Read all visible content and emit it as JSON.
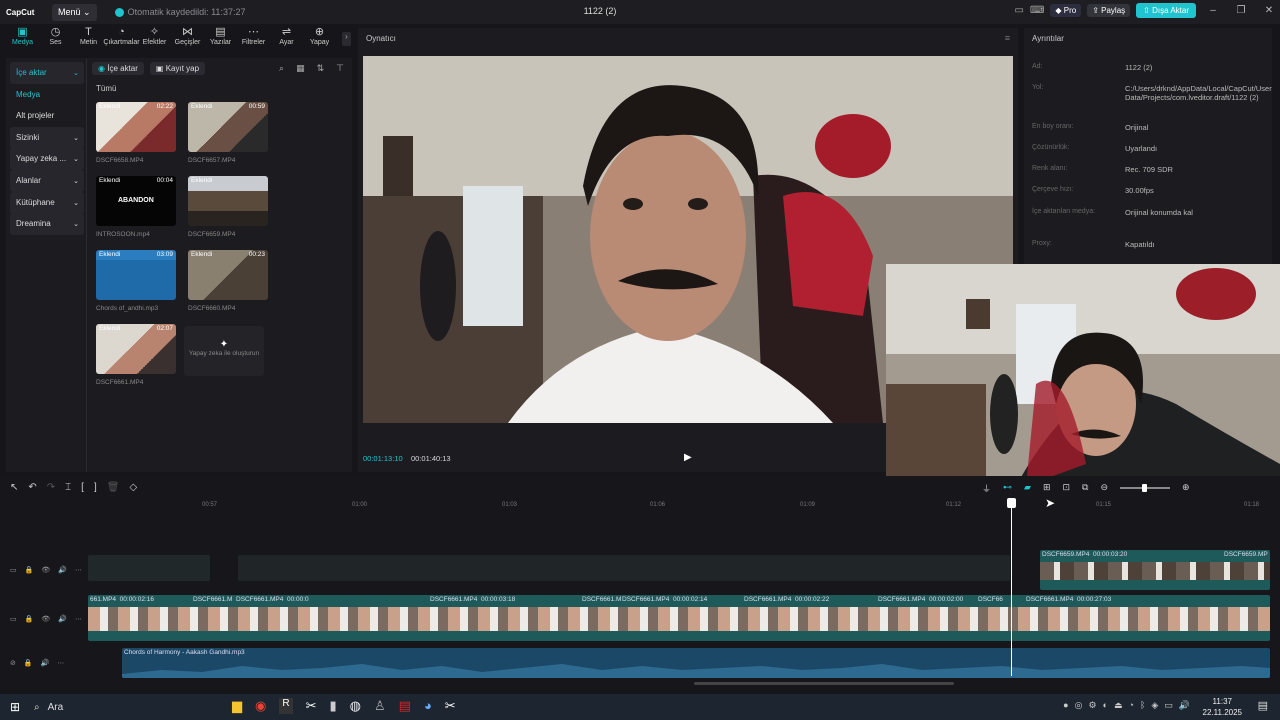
{
  "titlebar": {
    "logo": "CapCut",
    "menu_label": "Menü",
    "autosave": "Otomatik kaydedildi: 11:37:27",
    "project_title": "1122 (2)",
    "pro": "Pro",
    "share": "Paylaş",
    "export": "Dışa Aktar"
  },
  "tooltabs": [
    "Medya",
    "Ses",
    "Metin",
    "Çıkartmalar",
    "Efektler",
    "Geçişler",
    "Yazılar",
    "Filtreler",
    "Ayar",
    "Yapay"
  ],
  "sidebar": {
    "items": [
      {
        "label": "İçe aktar",
        "group": true
      },
      {
        "label": "Medya",
        "group": false
      },
      {
        "label": "Alt projeler",
        "group": false
      },
      {
        "label": "Sizinki",
        "group": true
      },
      {
        "label": "Yapay zeka ...",
        "group": true
      },
      {
        "label": "Alanlar",
        "group": true
      },
      {
        "label": "Kütüphane",
        "group": true
      },
      {
        "label": "Dreamina",
        "group": true
      }
    ]
  },
  "media": {
    "import_tab": "İçe aktar",
    "record_tab": "Kayıt yap",
    "all_label": "Tümü",
    "clips": [
      {
        "tag": "Eklendi",
        "duration": "02:22",
        "name": "DSCF6658.MP4"
      },
      {
        "tag": "Eklendi",
        "duration": "00:59",
        "name": "DSCF6657.MP4"
      },
      {
        "tag": "Eklendi",
        "duration": "00:04",
        "name": "INTROSOON.mp4",
        "overlay": "ABANDON"
      },
      {
        "tag": "Eklendi",
        "duration": "",
        "name": "DSCF6659.MP4"
      },
      {
        "tag": "Eklendi",
        "duration": "03:09",
        "name": "Chords of_andhi.mp3"
      },
      {
        "tag": "Eklendi",
        "duration": "00:23",
        "name": "DSCF6660.MP4"
      },
      {
        "tag": "Eklendi",
        "duration": "02:07",
        "name": "DSCF6661.MP4"
      }
    ],
    "ai_create": "Yapay zeka ile oluşturun"
  },
  "player": {
    "title": "Oynatıcı",
    "current_time": "00:01:13:10",
    "total_time": "00:01:40:13"
  },
  "details": {
    "title": "Ayrıntılar",
    "rows": [
      {
        "k": "Ad:",
        "v": "1122 (2)"
      },
      {
        "k": "Yol:",
        "v": "C:/Users/drknd/AppData/Local/CapCut/User Data/Projects/com.lveditor.draft/1122 (2)"
      },
      {
        "k": "En boy oranı:",
        "v": "Orijinal"
      },
      {
        "k": "Çözünürlük:",
        "v": "Uyarlandı"
      },
      {
        "k": "Renk alanı:",
        "v": "Rec. 709 SDR"
      },
      {
        "k": "Çerçeve hızı:",
        "v": "30.00fps"
      },
      {
        "k": "İçe aktarılan medya:",
        "v": "Orijinal konumda kal"
      },
      {
        "k": "Proxy:",
        "v": "Kapatıldı"
      }
    ]
  },
  "timeline": {
    "ruler": [
      "00:57",
      "01:00",
      "01:03",
      "01:06",
      "01:09",
      "01:12",
      "01:15",
      "01:18"
    ],
    "track1_clips": [
      {
        "name": "DSCF6659.MP4",
        "time": "00:00:03:20"
      },
      {
        "name": "DSCF6659.MP",
        "time": ""
      }
    ],
    "track2_clips": [
      {
        "name": "661.MP4",
        "time": "00:00:02:16"
      },
      {
        "name": "DSCF6661.M",
        "time": ""
      },
      {
        "name": "DSCF6661.MP4",
        "time": "00:00:0"
      },
      {
        "name": "DSCF6661.MP4",
        "time": "00:00:03:18"
      },
      {
        "name": "DSCF6661.M",
        "time": ""
      },
      {
        "name": "DSCF6661.MP4",
        "time": "00:00:02:14"
      },
      {
        "name": "DSCF6661.MP4",
        "time": "00:00:02:22"
      },
      {
        "name": "DSCF6661.MP4",
        "time": "00:00:02:00"
      },
      {
        "name": "DSCF66",
        "time": ""
      },
      {
        "name": "DSCF6661.MP4",
        "time": "00:00:27:03"
      }
    ],
    "audio_clip": "Chords of Harmony - Aakash Gandhi.mp3"
  },
  "taskbar": {
    "search": "Ara",
    "time": "11:37",
    "date": "22.11.2025"
  },
  "colors": {
    "accent": "#20c4cf",
    "track_video": "#1e5a5a",
    "track_audio": "#1c4868"
  }
}
